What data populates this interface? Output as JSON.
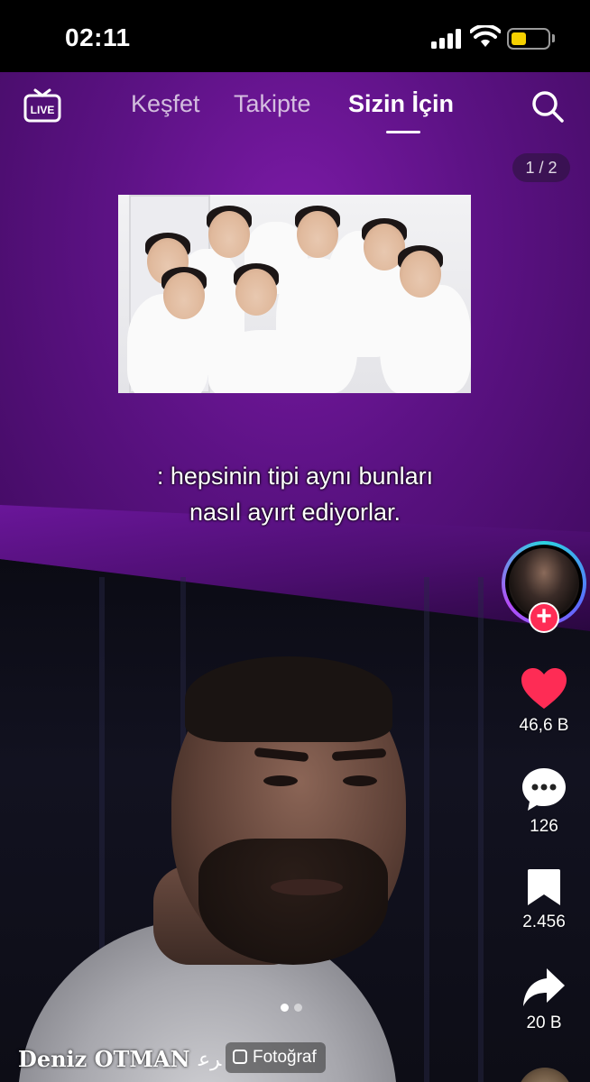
{
  "status_bar": {
    "time": "02:11"
  },
  "top_nav": {
    "live_label": "LIVE",
    "tabs": [
      {
        "label": "Keşfet",
        "active": false
      },
      {
        "label": "Takipte",
        "active": false
      },
      {
        "label": "Sizin İçin",
        "active": true
      }
    ]
  },
  "post": {
    "page_indicator": "1 / 2",
    "caption_lines": [
      ": hepsinin tipi aynı bunları",
      "nasıl ayırt ediyorlar."
    ],
    "author": "Deniz OTMAN",
    "author_glyph": "ﺮﻋ",
    "post_type": "Fotoğraf",
    "carousel": {
      "total": 2,
      "current": 1
    }
  },
  "actions": {
    "likes": "46,6 B",
    "comments": "126",
    "saves": "2.456",
    "shares": "20 B"
  },
  "colors": {
    "accent_red": "#fe2c55",
    "purple": "#6a169a"
  },
  "icons": [
    "live-icon",
    "search-icon",
    "heart-icon",
    "comment-icon",
    "bookmark-icon",
    "share-icon",
    "plus-icon"
  ]
}
